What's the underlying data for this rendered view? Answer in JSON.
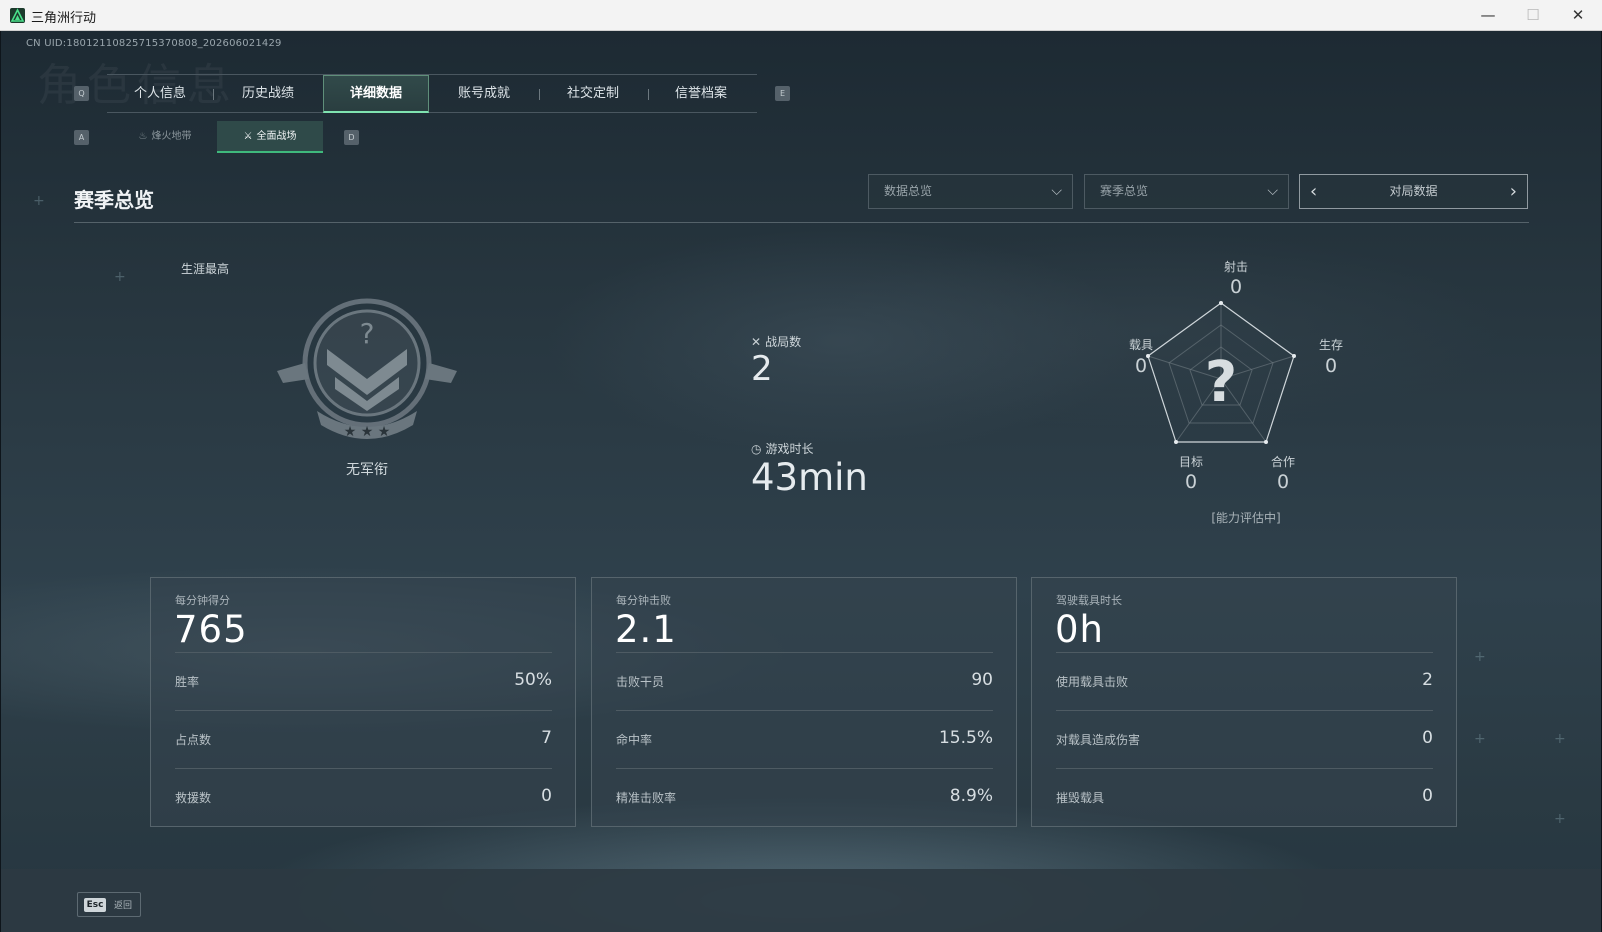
{
  "window": {
    "title": "三角洲行动",
    "minimize": "—",
    "maximize": "☐",
    "close": "✕"
  },
  "uid": "CN UID:18012110825715370808_202606021429",
  "watermark": "角色信息",
  "keys": {
    "prev_tab": "Q",
    "next_tab": "E",
    "prev_sub": "A",
    "next_sub": "D"
  },
  "main_tabs": [
    "个人信息",
    "历史战绩",
    "详细数据",
    "账号成就",
    "社交定制",
    "信誉档案"
  ],
  "active_main_tab": "详细数据",
  "sub_tabs": [
    {
      "label": "烽火地带",
      "icon": "fire-zone-icon"
    },
    {
      "label": "全面战场",
      "icon": "battlefield-icon"
    }
  ],
  "active_sub_tab": "全面战场",
  "section": {
    "title": "赛季总览"
  },
  "filters": {
    "data_dropdown": "数据总览",
    "season_dropdown": "赛季总览",
    "pager_label": "对局数据"
  },
  "career": {
    "label": "生涯最高",
    "rank": "无军衔"
  },
  "summary": {
    "matches_label": "战局数",
    "matches_value": "2",
    "time_label": "游戏时长",
    "time_value": "43min"
  },
  "radar": {
    "axes": [
      {
        "name": "射击",
        "value": "0"
      },
      {
        "name": "生存",
        "value": "0"
      },
      {
        "name": "合作",
        "value": "0"
      },
      {
        "name": "目标",
        "value": "0"
      },
      {
        "name": "载具",
        "value": "0"
      }
    ],
    "center_mark": "?",
    "status": "[能力评估中]"
  },
  "cards": [
    {
      "head_label": "每分钟得分",
      "head_value": "765",
      "rows": [
        {
          "label": "胜率",
          "value": "50%"
        },
        {
          "label": "占点数",
          "value": "7"
        },
        {
          "label": "救援数",
          "value": "0"
        }
      ]
    },
    {
      "head_label": "每分钟击败",
      "head_value": "2.1",
      "rows": [
        {
          "label": "击败干员",
          "value": "90"
        },
        {
          "label": "命中率",
          "value": "15.5%"
        },
        {
          "label": "精准击败率",
          "value": "8.9%"
        }
      ]
    },
    {
      "head_label": "驾驶载具时长",
      "head_value": "0h",
      "rows": [
        {
          "label": "使用载具击败",
          "value": "2"
        },
        {
          "label": "对载具造成伤害",
          "value": "0"
        },
        {
          "label": "摧毁载具",
          "value": "0"
        }
      ]
    }
  ],
  "footer": {
    "esc_key": "Esc",
    "esc_label": "返回"
  },
  "colors": {
    "accent_green": "#7fe3b0",
    "active_tab_bg": "#314a4a",
    "panel_bg": "#34444e"
  }
}
